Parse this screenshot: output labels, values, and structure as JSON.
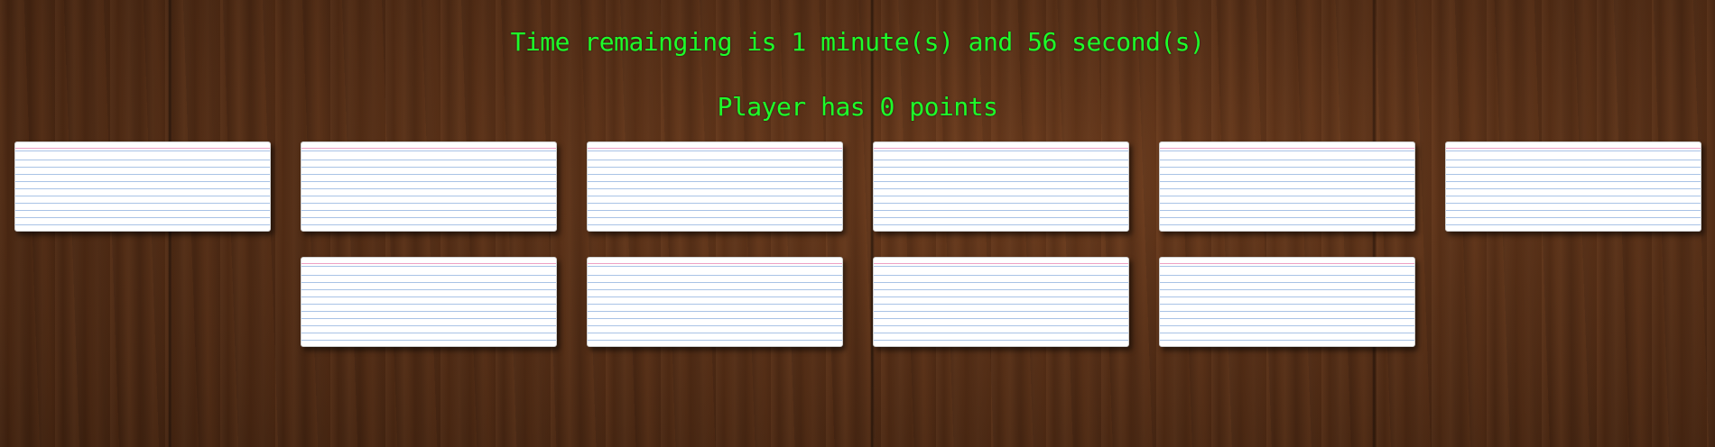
{
  "hud": {
    "timer_text": "Time remainging is 1 minute(s) and 56 second(s)",
    "score_text": "Player has 0 points"
  },
  "colors": {
    "hud_text": "#1dff2a",
    "card_face": "#ffffff",
    "card_rule_lines": "#a9c3e6",
    "card_margin_line": "#e778aa",
    "table_wood": "#552e16"
  },
  "cards": [
    {
      "state": "face-down",
      "text": ""
    },
    {
      "state": "face-down",
      "text": ""
    },
    {
      "state": "face-down",
      "text": ""
    },
    {
      "state": "face-down",
      "text": ""
    },
    {
      "state": "face-down",
      "text": ""
    },
    {
      "state": "face-down",
      "text": ""
    },
    {
      "state": "face-down",
      "text": ""
    },
    {
      "state": "face-down",
      "text": ""
    },
    {
      "state": "face-down",
      "text": ""
    },
    {
      "state": "face-down",
      "text": ""
    }
  ]
}
